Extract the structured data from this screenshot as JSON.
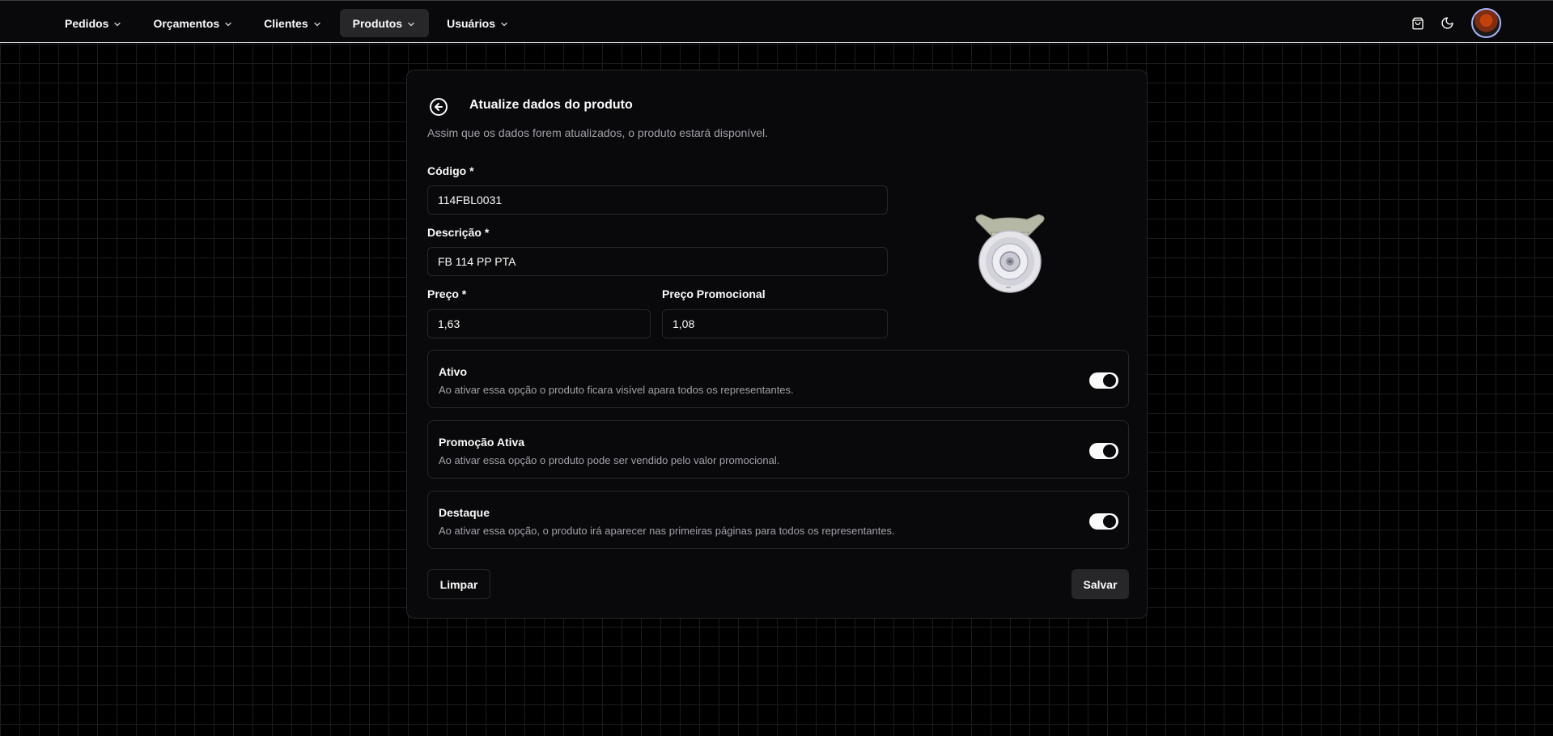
{
  "nav": {
    "items": [
      {
        "label": "Pedidos",
        "active": false
      },
      {
        "label": "Orçamentos",
        "active": false
      },
      {
        "label": "Clientes",
        "active": false
      },
      {
        "label": "Produtos",
        "active": true
      },
      {
        "label": "Usuários",
        "active": false
      }
    ],
    "icons": [
      "cart-icon",
      "moon-icon"
    ]
  },
  "form": {
    "title": "Atualize dados do produto",
    "subtitle": "Assim que os dados forem atualizados, o produto estará disponível.",
    "codigo_label": "Código *",
    "codigo_value": "114FBL0031",
    "descricao_label": "Descrição *",
    "descricao_value": "FB 114 PP PTA",
    "preco_label": "Preço *",
    "preco_value": "1,63",
    "preco_promo_label": "Preço Promocional",
    "preco_promo_value": "1,08",
    "switches": [
      {
        "title": "Ativo",
        "desc": "Ao ativar essa opção o produto ficara visível apara todos os representantes.",
        "on": true
      },
      {
        "title": "Promoção Ativa",
        "desc": "Ao ativar essa opção o produto pode ser vendido pelo valor promocional.",
        "on": true
      },
      {
        "title": "Destaque",
        "desc": "Ao ativar essa opção, o produto irá aparecer nas primeiras páginas para todos os representantes.",
        "on": true
      }
    ],
    "clear_label": "Limpar",
    "save_label": "Salvar"
  },
  "colors": {
    "background": "#000000",
    "card": "#09090b",
    "border": "#27272a",
    "muted_text": "#a1a1aa",
    "accent": "#fafafa"
  }
}
